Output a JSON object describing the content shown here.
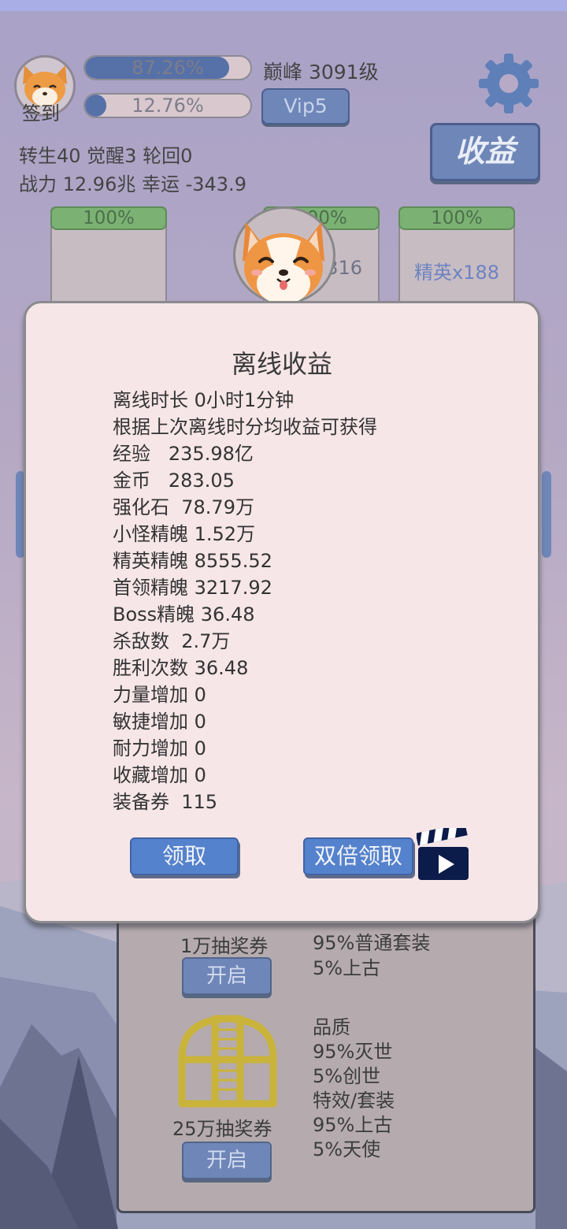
{
  "header": {
    "signin_label": "签到",
    "bar1_text": "87.26%",
    "bar1_value": 0.8726,
    "bar2_text": "12.76%",
    "bar2_value": 0.1276,
    "level_text": "巅峰 3091级",
    "vip_label": "Vip5",
    "stats_line1": "转生40 觉醒3 轮回0",
    "stats_line2": "战力 12.96兆  幸运 -343.9",
    "earnings_button": "收益"
  },
  "cards": [
    {
      "hp": "100%",
      "label": ""
    },
    {
      "hp": "100%",
      "label": "x316"
    },
    {
      "hp": "100%",
      "label": "精英x188"
    }
  ],
  "lower_panel": {
    "ticket1_label": "1万抽奖券",
    "ticket1_open": "开启",
    "ticket1_odds": [
      "95%普通套装",
      "5%上古"
    ],
    "ticket2_label": "25万抽奖券",
    "ticket2_open": "开启",
    "ticket2_odds": [
      "品质",
      "95%灭世",
      "5%创世",
      "特效/套装",
      "95%上古",
      "5%天使"
    ]
  },
  "offline_dialog": {
    "title": "离线收益",
    "lines": [
      "离线时长 0小时1分钟",
      "根据上次离线时分均收益可获得",
      "经验   235.98亿",
      "金币   283.05",
      "强化石  78.79万",
      "小怪精魄 1.52万",
      "精英精魄 8555.52",
      "首领精魄 3217.92",
      "Boss精魄 36.48",
      "杀敌数  2.7万",
      "胜利次数 36.48",
      "力量增加 0",
      "敏捷增加 0",
      "耐力增加 0",
      "收藏增加 0",
      "装备券  115"
    ],
    "claim_button": "领取",
    "double_claim_button": "双倍领取",
    "video_icon": "clapperboard-icon"
  },
  "colors": {
    "accent_blue": "#5582cc",
    "button_blue": "#6f86b8",
    "hp_green": "#7bb274",
    "dialog_bg": "#f6e6e8"
  }
}
